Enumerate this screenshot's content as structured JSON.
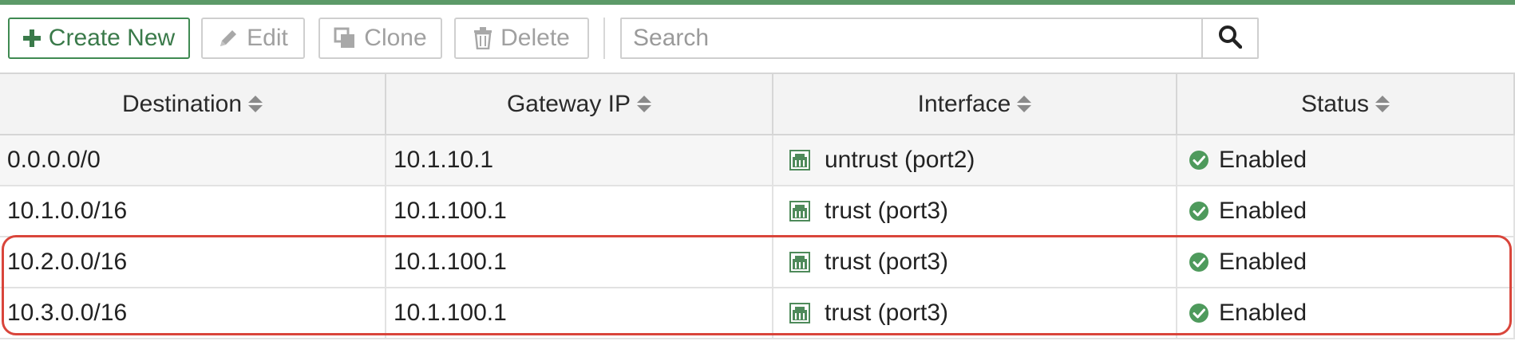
{
  "toolbar": {
    "create_label": "Create New",
    "edit_label": "Edit",
    "clone_label": "Clone",
    "delete_label": "Delete",
    "search_placeholder": "Search",
    "search_value": ""
  },
  "columns": [
    "Destination",
    "Gateway IP",
    "Interface",
    "Status"
  ],
  "rows": [
    {
      "destination": "0.0.0.0/0",
      "gateway": "10.1.10.1",
      "interface": "untrust (port2)",
      "status": "Enabled"
    },
    {
      "destination": "10.1.0.0/16",
      "gateway": "10.1.100.1",
      "interface": "trust (port3)",
      "status": "Enabled"
    },
    {
      "destination": "10.2.0.0/16",
      "gateway": "10.1.100.1",
      "interface": "trust (port3)",
      "status": "Enabled"
    },
    {
      "destination": "10.3.0.0/16",
      "gateway": "10.1.100.1",
      "interface": "trust (port3)",
      "status": "Enabled"
    }
  ],
  "icons": {
    "create": "plus-icon",
    "edit": "pencil-icon",
    "clone": "clone-icon",
    "delete": "trash-icon",
    "search": "search-icon",
    "interface": "ethernet-port-icon",
    "status": "check-circle-icon",
    "sort": "sort-icon"
  },
  "colors": {
    "accent": "#5c9a68",
    "primary_button": "#3f8a52",
    "status_ok": "#4e9a5c",
    "highlight": "#d9453b"
  }
}
